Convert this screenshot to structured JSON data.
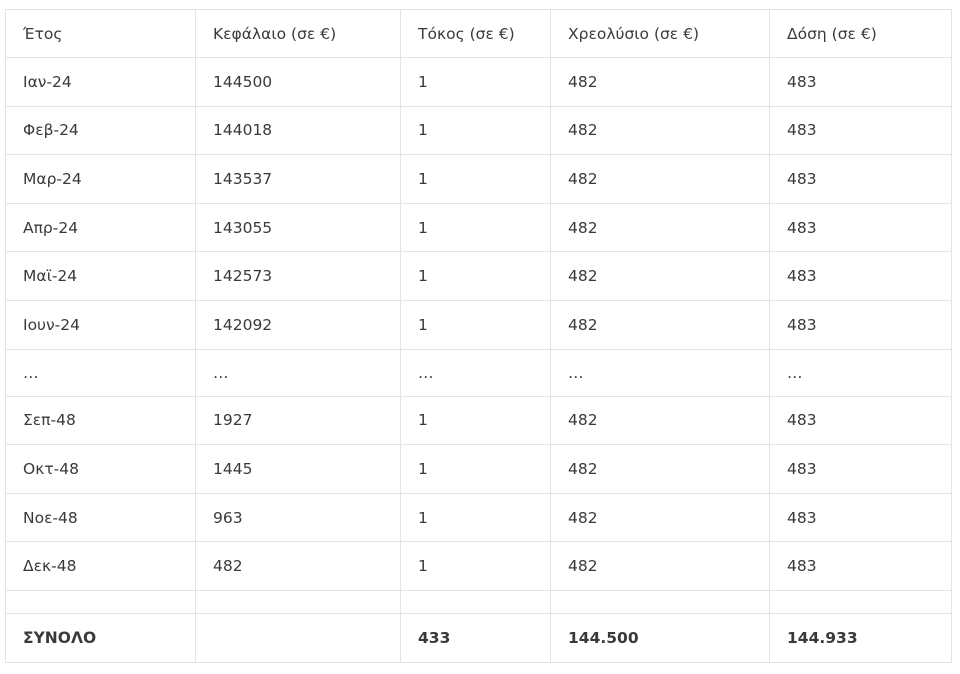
{
  "table": {
    "headers": [
      "Έτος",
      "Κεφάλαιο (σε €)",
      "Τόκος (σε €)",
      "Χρεολύσιο (σε €)",
      "Δόση (σε €)"
    ],
    "rows": [
      [
        "Ιαν-24",
        "144500",
        "1",
        "482",
        "483"
      ],
      [
        "Φεβ-24",
        "144018",
        "1",
        "482",
        "483"
      ],
      [
        "Μαρ-24",
        "143537",
        "1",
        "482",
        "483"
      ],
      [
        "Απρ-24",
        "143055",
        "1",
        "482",
        "483"
      ],
      [
        "Μαϊ-24",
        "142573",
        "1",
        "482",
        "483"
      ],
      [
        "Ιουν-24",
        "142092",
        "1",
        "482",
        "483"
      ],
      [
        "…",
        "…",
        "…",
        "…",
        "…"
      ],
      [
        "Σεπ-48",
        "1927",
        "1",
        "482",
        "483"
      ],
      [
        "Οκτ-48",
        "1445",
        "1",
        "482",
        "483"
      ],
      [
        "Νοε-48",
        "963",
        "1",
        "482",
        "483"
      ],
      [
        "Δεκ-48",
        "482",
        "1",
        "482",
        "483"
      ]
    ],
    "total": [
      "ΣΥΝΟΛΟ",
      "",
      "433",
      "144.500",
      "144.933"
    ]
  }
}
